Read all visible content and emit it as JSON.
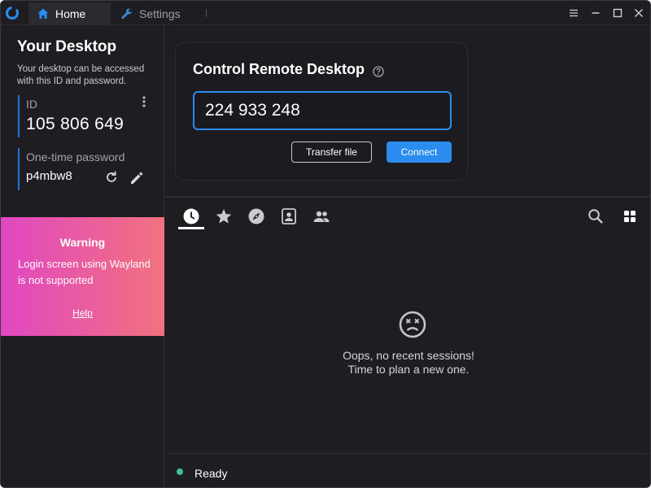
{
  "titlebar": {
    "tabs": [
      {
        "label": "Home",
        "icon": "home-icon",
        "active": true
      },
      {
        "label": "Settings",
        "icon": "wrench-icon",
        "active": false
      }
    ],
    "window_controls": [
      "menu-icon",
      "minimize-icon",
      "maximize-icon",
      "close-icon"
    ]
  },
  "left_panel": {
    "title": "Your Desktop",
    "description": "Your desktop can be accessed with this ID and password.",
    "id_label": "ID",
    "id_value": "105 806 649",
    "password_label": "One-time password",
    "password_value": "p4mbw8",
    "warning": {
      "title": "Warning",
      "text": "Login screen using Wayland is not supported",
      "link": "Help"
    }
  },
  "control": {
    "title": "Control Remote Desktop",
    "id_input_value": "224 933 248",
    "transfer_label": "Transfer file",
    "connect_label": "Connect"
  },
  "peers": {
    "tabs": [
      {
        "name": "recent",
        "icon": "clock-icon",
        "active": true
      },
      {
        "name": "favorites",
        "icon": "star-icon",
        "active": false
      },
      {
        "name": "discovered",
        "icon": "compass-icon",
        "active": false
      },
      {
        "name": "address-book",
        "icon": "contact-card-icon",
        "active": false
      },
      {
        "name": "group",
        "icon": "people-icon",
        "active": false
      }
    ],
    "empty_line1": "Oops, no recent sessions!",
    "empty_line2": "Time to plan a new one."
  },
  "status": {
    "text": "Ready",
    "color": "#3fc08e"
  },
  "colors": {
    "accent": "#2b8cef",
    "background": "#1e1e22",
    "warning_gradient_start": "#e147c2",
    "warning_gradient_end": "#f2727e"
  }
}
